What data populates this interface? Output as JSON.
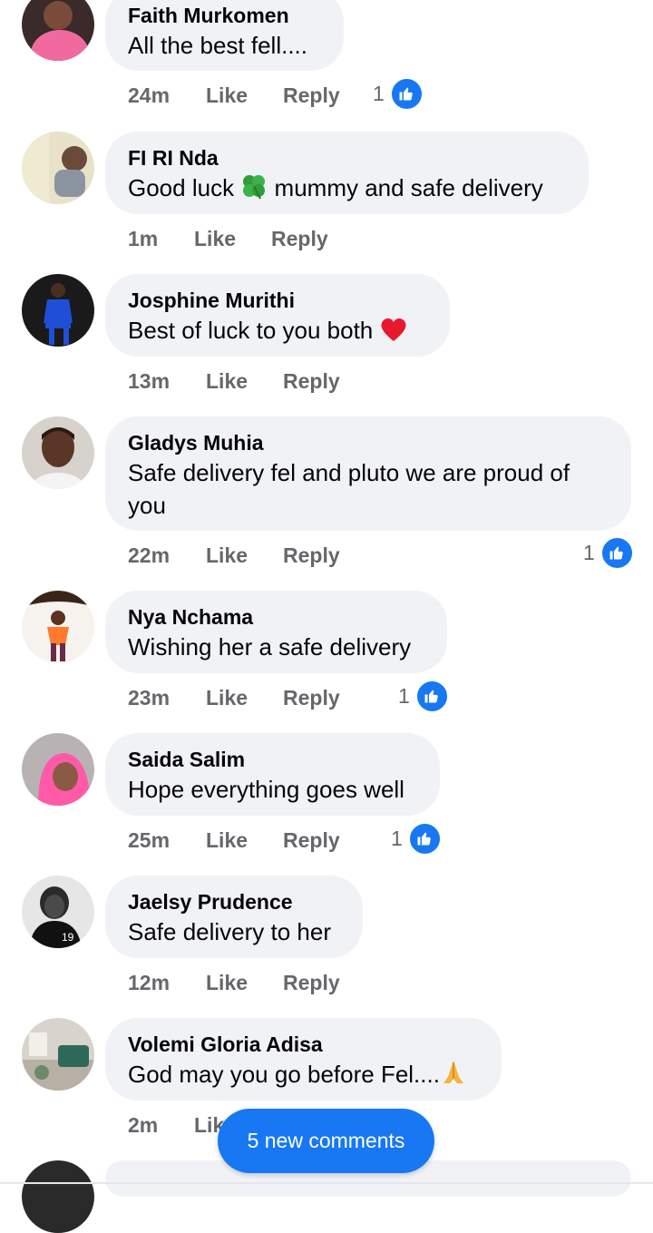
{
  "comments": [
    {
      "name": "Faith Murkomen",
      "text": "All the best fell....",
      "time": "24m",
      "like": "Like",
      "reply": "Reply",
      "likes": "1",
      "avatar": "avatar-pink"
    },
    {
      "name": "FI RI Nda",
      "text_before": "Good luck",
      "text_after": "mummy and safe delivery",
      "emoji": "four-leaf-clover",
      "time": "1m",
      "like": "Like",
      "reply": "Reply",
      "avatar": "avatar-child"
    },
    {
      "name": "Josphine Murithi",
      "text": "Best of luck to you both",
      "emoji": "red-heart",
      "time": "13m",
      "like": "Like",
      "reply": "Reply",
      "avatar": "avatar-blue-suit"
    },
    {
      "name": "Gladys Muhia",
      "text": "Safe delivery fel and pluto we are proud of you",
      "time": "22m",
      "like": "Like",
      "reply": "Reply",
      "likes": "1",
      "avatar": "avatar-woman"
    },
    {
      "name": "Nya Nchama",
      "text": "Wishing her a safe delivery",
      "time": "23m",
      "like": "Like",
      "reply": "Reply",
      "likes": "1",
      "avatar": "avatar-orange"
    },
    {
      "name": "Saida Salim",
      "text": "Hope everything goes well",
      "time": "25m",
      "like": "Like",
      "reply": "Reply",
      "likes": "1",
      "avatar": "avatar-hijab"
    },
    {
      "name": "Jaelsy Prudence",
      "text": "Safe delivery to her",
      "time": "12m",
      "like": "Like",
      "reply": "Reply",
      "avatar": "avatar-bw"
    },
    {
      "name": "Volemi Gloria Adisa",
      "text": "God may you go before Fel....",
      "emoji": "folded-hands",
      "time": "2m",
      "like": "Like",
      "avatar": "avatar-room"
    }
  ],
  "new_comments_label": "5 new comments",
  "colors": {
    "accent": "#1877f2",
    "bubble": "#f0f2f5",
    "meta": "#65676b"
  }
}
